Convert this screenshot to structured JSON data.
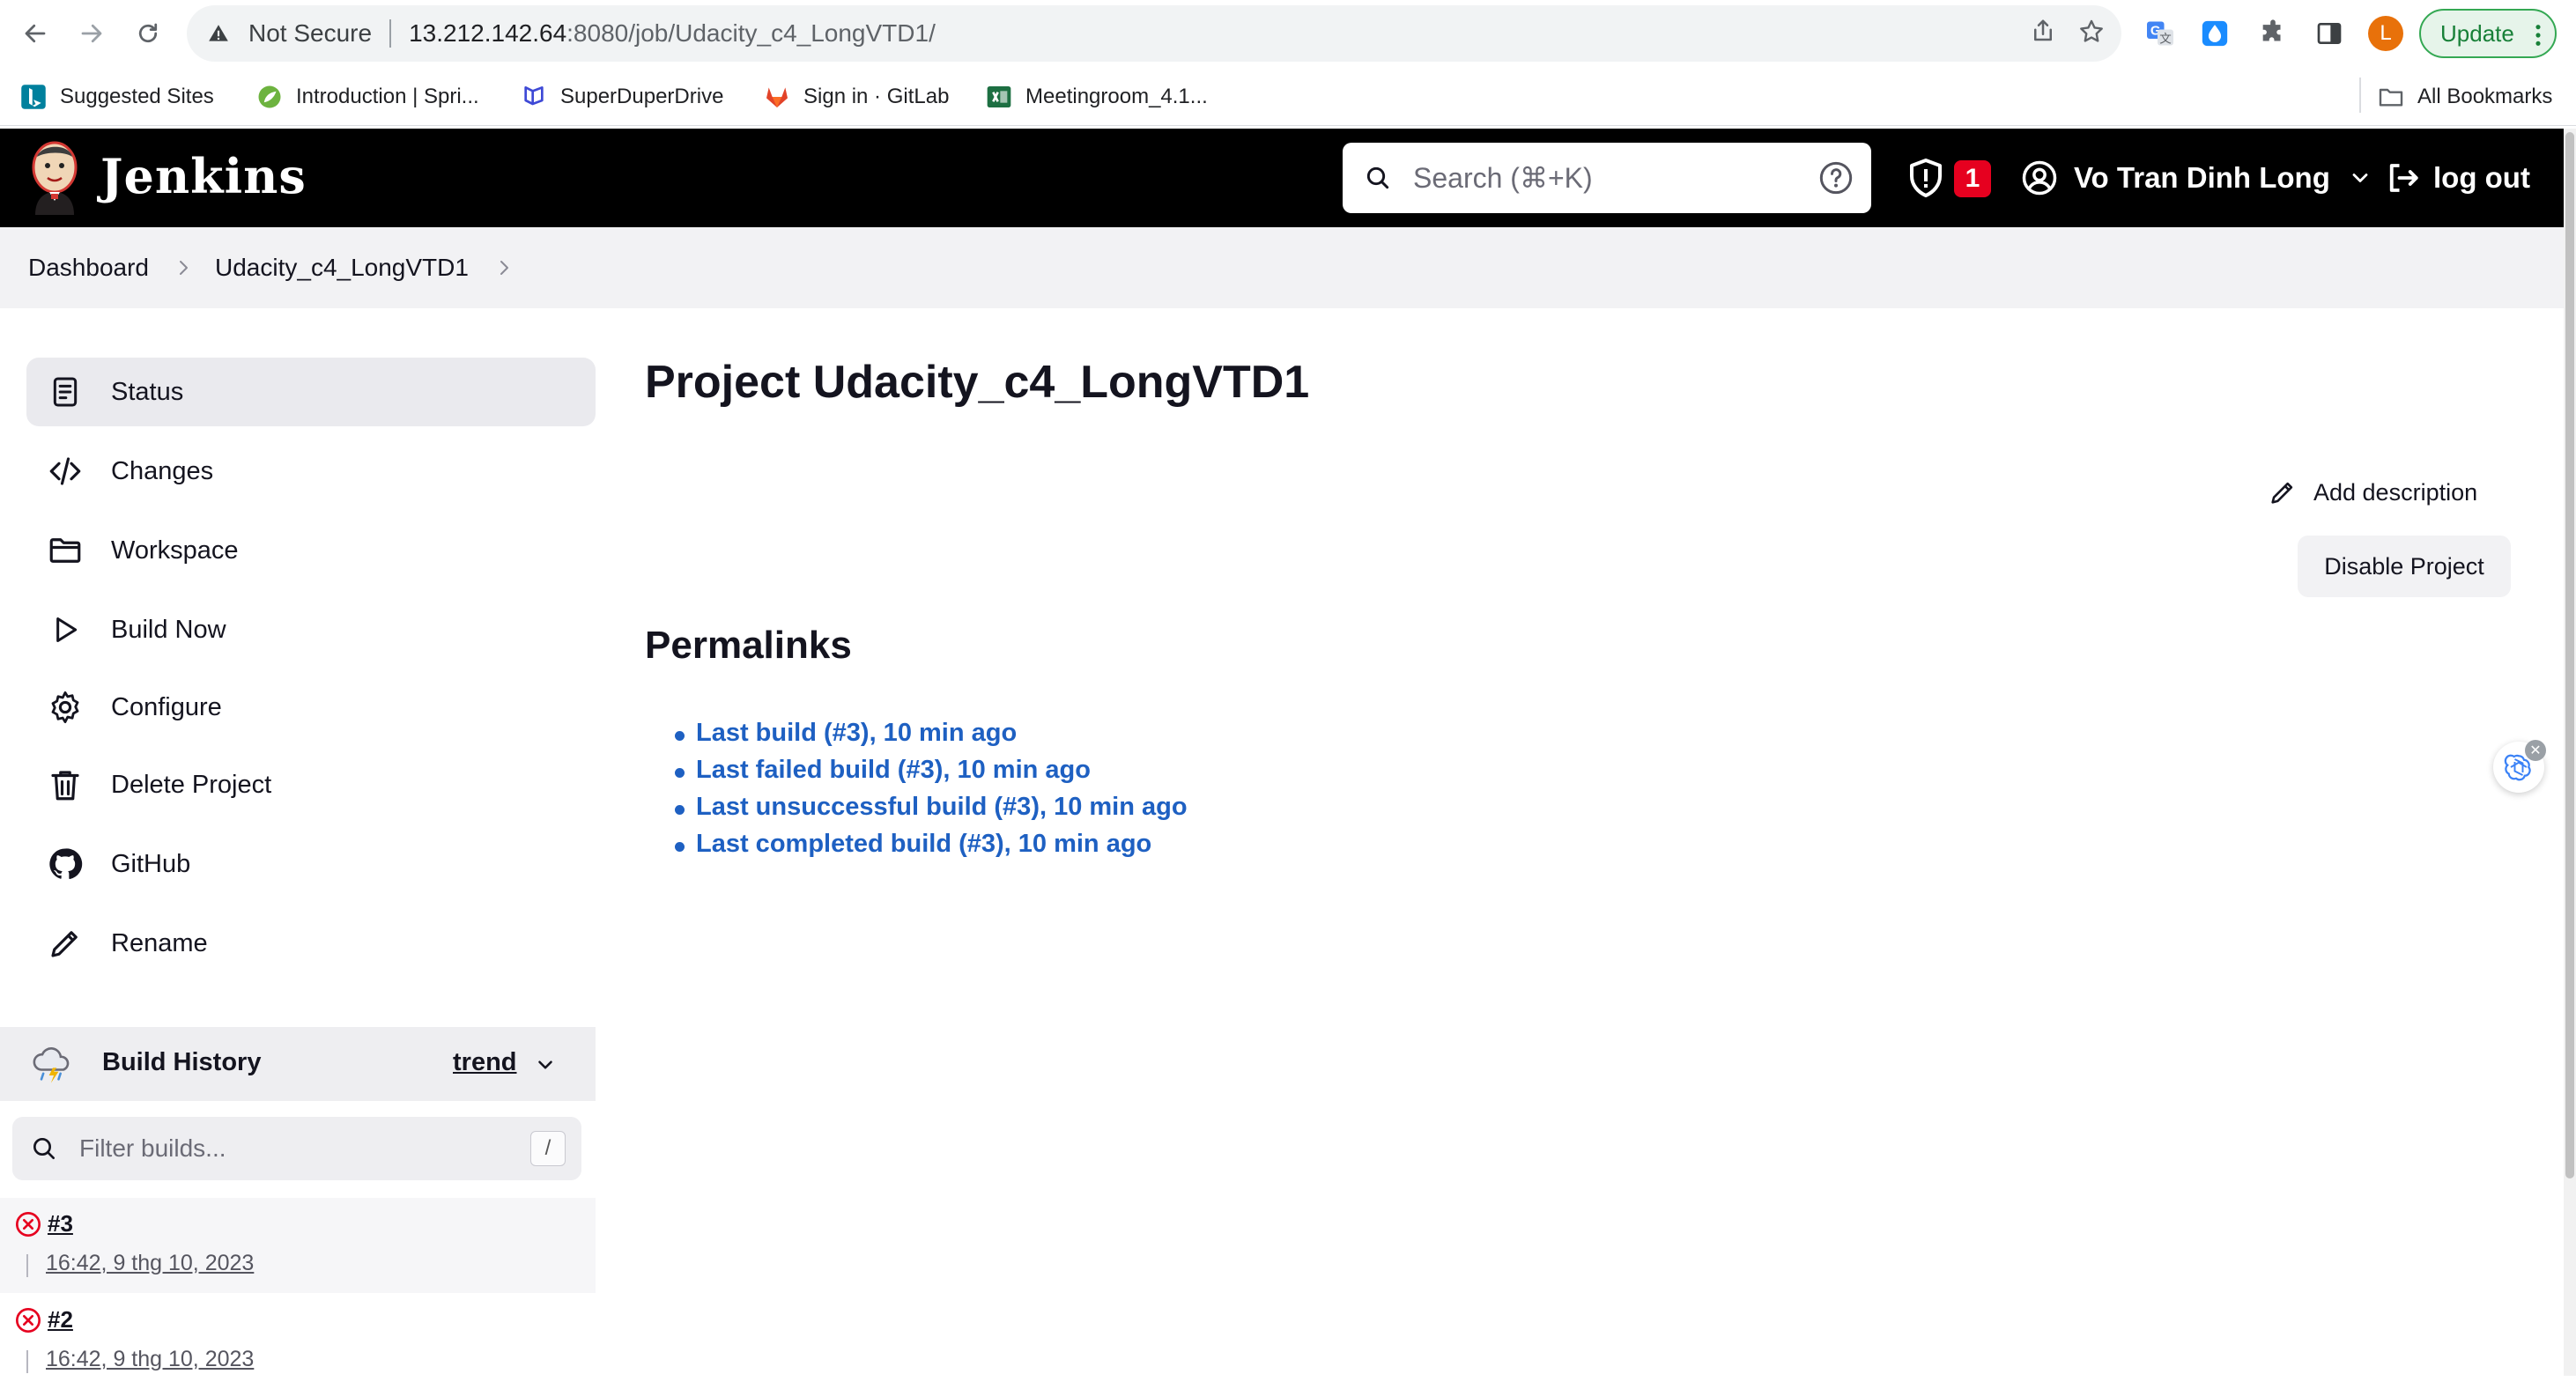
{
  "browser": {
    "security_label": "Not Secure",
    "url_host": "13.212.142.64",
    "url_rest": ":8080/job/Udacity_c4_LongVTD1/",
    "profile_initial": "L",
    "update_label": "Update",
    "bookmarks": [
      "Suggested Sites",
      "Introduction | Spri...",
      "SuperDuperDrive",
      "Sign in · GitLab",
      "Meetingroom_4.1...",
      "All Bookmarks"
    ]
  },
  "header": {
    "app_name": "Jenkins",
    "search_placeholder": "Search (⌘+K)",
    "security_alert_count": "1",
    "user_name": "Vo Tran Dinh Long",
    "logout_label": "log out"
  },
  "breadcrumb": [
    "Dashboard",
    "Udacity_c4_LongVTD1"
  ],
  "sidebar": {
    "tasks": [
      "Status",
      "Changes",
      "Workspace",
      "Build Now",
      "Configure",
      "Delete Project",
      "GitHub",
      "Rename"
    ]
  },
  "build_history": {
    "title": "Build History",
    "trend_label": "trend",
    "filter_placeholder": "Filter builds...",
    "filter_shortcut": "/",
    "builds": [
      {
        "number": "#3",
        "time": "16:42, 9 thg 10, 2023",
        "status": "failed"
      },
      {
        "number": "#2",
        "time": "16:42, 9 thg 10, 2023",
        "status": "failed"
      }
    ]
  },
  "main": {
    "title": "Project Udacity_c4_LongVTD1",
    "add_description_label": "Add description",
    "disable_button_label": "Disable Project",
    "permalinks_title": "Permalinks",
    "permalinks": [
      "Last build (#3), 10 min ago",
      "Last failed build (#3), 10 min ago",
      "Last unsuccessful build (#3), 10 min ago",
      "Last completed build (#3), 10 min ago"
    ]
  },
  "colors": {
    "header_bg": "#000000",
    "link": "#1e60c2",
    "alert": "#e6001f",
    "fail": "#e6001f"
  }
}
